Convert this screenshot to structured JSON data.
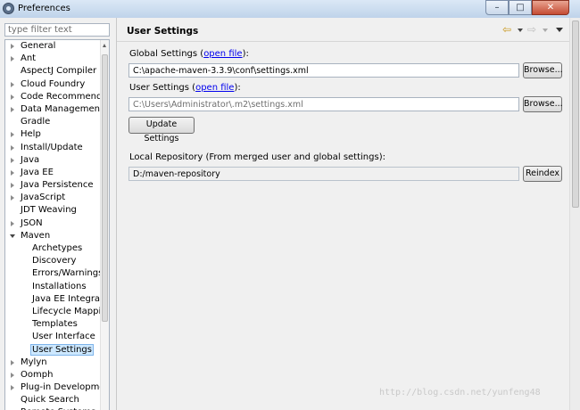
{
  "window": {
    "title": "Preferences",
    "minimize_glyph": "–",
    "maximize_glyph": "□",
    "close_glyph": "✕"
  },
  "filter": {
    "placeholder": "type filter text"
  },
  "tree": [
    {
      "label": "General",
      "level": 0,
      "expander": "closed"
    },
    {
      "label": "Ant",
      "level": 0,
      "expander": "closed"
    },
    {
      "label": "AspectJ Compiler",
      "level": 0,
      "expander": "none"
    },
    {
      "label": "Cloud Foundry",
      "level": 0,
      "expander": "closed"
    },
    {
      "label": "Code Recommenders",
      "level": 0,
      "expander": "closed"
    },
    {
      "label": "Data Management",
      "level": 0,
      "expander": "closed"
    },
    {
      "label": "Gradle",
      "level": 0,
      "expander": "none"
    },
    {
      "label": "Help",
      "level": 0,
      "expander": "closed"
    },
    {
      "label": "Install/Update",
      "level": 0,
      "expander": "closed"
    },
    {
      "label": "Java",
      "level": 0,
      "expander": "closed"
    },
    {
      "label": "Java EE",
      "level": 0,
      "expander": "closed"
    },
    {
      "label": "Java Persistence",
      "level": 0,
      "expander": "closed"
    },
    {
      "label": "JavaScript",
      "level": 0,
      "expander": "closed"
    },
    {
      "label": "JDT Weaving",
      "level": 0,
      "expander": "none"
    },
    {
      "label": "JSON",
      "level": 0,
      "expander": "closed"
    },
    {
      "label": "Maven",
      "level": 0,
      "expander": "open"
    },
    {
      "label": "Archetypes",
      "level": 1,
      "expander": "none"
    },
    {
      "label": "Discovery",
      "level": 1,
      "expander": "none"
    },
    {
      "label": "Errors/Warnings",
      "level": 1,
      "expander": "none"
    },
    {
      "label": "Installations",
      "level": 1,
      "expander": "none"
    },
    {
      "label": "Java EE Integration",
      "level": 1,
      "expander": "none"
    },
    {
      "label": "Lifecycle Mappings",
      "level": 1,
      "expander": "none"
    },
    {
      "label": "Templates",
      "level": 1,
      "expander": "none"
    },
    {
      "label": "User Interface",
      "level": 1,
      "expander": "none"
    },
    {
      "label": "User Settings",
      "level": 1,
      "expander": "none",
      "selected": true
    },
    {
      "label": "Mylyn",
      "level": 0,
      "expander": "closed"
    },
    {
      "label": "Oomph",
      "level": 0,
      "expander": "closed"
    },
    {
      "label": "Plug-in Development",
      "level": 0,
      "expander": "closed"
    },
    {
      "label": "Quick Search",
      "level": 0,
      "expander": "none"
    },
    {
      "label": "Remote Systems",
      "level": 0,
      "expander": "closed"
    }
  ],
  "panel": {
    "title": "User Settings",
    "back_icon": "⇦",
    "forward_icon": "⇨",
    "global": {
      "label_prefix": "Global Settings (",
      "link": "open file",
      "label_suffix": "):",
      "value": "C:\\apache-maven-3.3.9\\conf\\settings.xml",
      "browse": "Browse..."
    },
    "user": {
      "label_prefix": "User Settings (",
      "link": "open file",
      "label_suffix": "):",
      "value": "C:\\Users\\Administrator\\.m2\\settings.xml",
      "browse": "Browse..."
    },
    "update_button": "Update Settings",
    "local_repo": {
      "label": "Local Repository (From merged user and global settings):",
      "value": "D:/maven-repository",
      "reindex": "Reindex"
    }
  },
  "watermark": "http://blog.csdn.net/yunfeng48"
}
